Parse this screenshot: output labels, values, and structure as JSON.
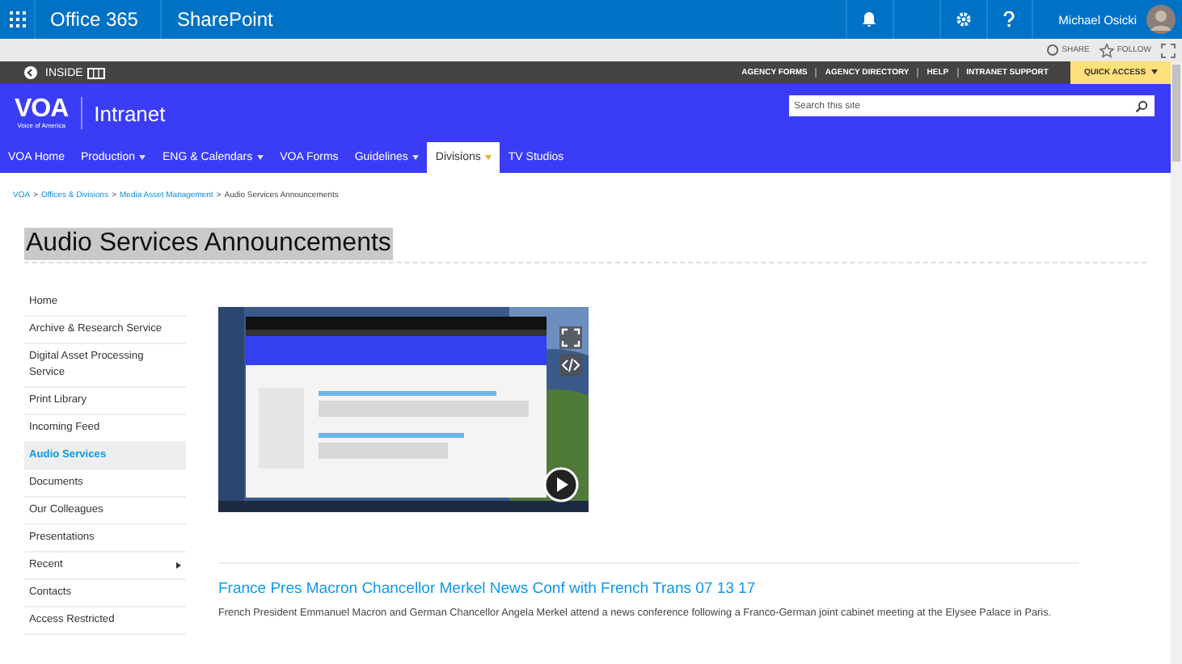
{
  "suite_bar": {
    "app_launcher": true,
    "brand": "Office 365",
    "app": "SharePoint",
    "user": "Michael Osicki"
  },
  "actions": [
    {
      "label": "SHARE",
      "kind": "share"
    },
    {
      "label": "FOLLOW",
      "kind": "follow"
    }
  ],
  "utility_bar": {
    "inside": "INSIDE",
    "links": [
      "AGENCY FORMS",
      "AGENCY DIRECTORY",
      "HELP",
      "INTRANET SUPPORT"
    ],
    "quick_access": "QUICK ACCESS"
  },
  "header": {
    "logo": "VOA",
    "logo_caption": "Voice of America",
    "site": "Intranet",
    "search": {
      "placeholder": "Search this site"
    }
  },
  "nav": [
    {
      "label": "VOA Home",
      "dropdown": false,
      "selected": false
    },
    {
      "label": "Production",
      "dropdown": true,
      "selected": false
    },
    {
      "label": "ENG & Calendars",
      "dropdown": true,
      "selected": false
    },
    {
      "label": "VOA Forms",
      "dropdown": false,
      "selected": false
    },
    {
      "label": "Guidelines",
      "dropdown": true,
      "selected": false
    },
    {
      "label": "Divisions",
      "dropdown": true,
      "selected": true
    },
    {
      "label": "TV Studios",
      "dropdown": false,
      "selected": false
    }
  ],
  "breadcrumb": [
    {
      "label": "VOA",
      "link": true
    },
    {
      "separator": ">",
      "label": "Offices & Divisions",
      "link": true
    },
    {
      "separator": ">",
      "label": "Media Asset Management",
      "link": true
    },
    {
      "separator": ">",
      "label": "Audio Services Announcements",
      "link": false
    }
  ],
  "page_title": "Audio Services Announcements",
  "sidebar": {
    "items": [
      {
        "label": "Home",
        "selected": false,
        "submenu": false
      },
      {
        "label": "Archive & Research Service",
        "selected": false,
        "submenu": false
      },
      {
        "label": "Digital Asset Processing Service",
        "selected": false,
        "submenu": false
      },
      {
        "label": "Print Library",
        "selected": false,
        "submenu": false
      },
      {
        "label": "Incoming Feed",
        "selected": false,
        "submenu": false
      },
      {
        "label": "Audio Services",
        "selected": true,
        "submenu": false
      },
      {
        "label": "Documents",
        "selected": false,
        "submenu": false
      },
      {
        "label": "Our Colleagues",
        "selected": false,
        "submenu": false
      },
      {
        "label": "Presentations",
        "selected": false,
        "submenu": false
      },
      {
        "label": "Recent",
        "selected": false,
        "submenu": true
      },
      {
        "label": "Contacts",
        "selected": false,
        "submenu": false
      },
      {
        "label": "Access Restricted",
        "selected": false,
        "submenu": false
      }
    ]
  },
  "posts": [
    {
      "title": "France Pres Macron Chancellor Merkel News Conf with French Trans 07 13 17",
      "summary": "French President Emmanuel Macron and German Chancellor Angela Merkel attend a news conference following a Franco-German joint cabinet meeting at the Elysee Palace in Paris."
    }
  ]
}
